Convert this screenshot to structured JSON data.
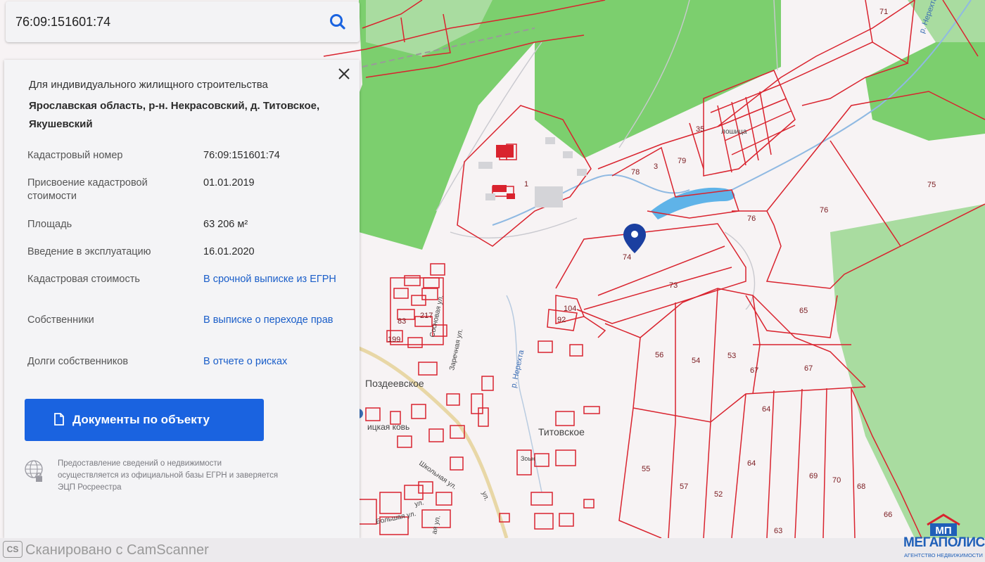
{
  "search": {
    "value": "76:09:151601:74"
  },
  "panel": {
    "purpose": "Для индивидуального жилищного строительства",
    "address": "Ярославская область, р-н. Некрасовский, д. Титовское, Якушевский",
    "rows": [
      {
        "label": "Кадастровый номер",
        "value": "76:09:151601:74"
      },
      {
        "label": "Присвоение кадастровой стоимости",
        "value": "01.01.2019"
      },
      {
        "label": "Площадь",
        "value": "63 206 м²"
      },
      {
        "label": "Введение в эксплуатацию",
        "value": "16.01.2020"
      },
      {
        "label": "Кадастровая стоимость",
        "value": "В срочной выписке из ЕГРН"
      },
      {
        "label": "Собственники",
        "value": "В выписке о переходе прав"
      },
      {
        "label": "Долги собственников",
        "value": "В отчете о рисках"
      }
    ],
    "documents_button": "Документы по объекту",
    "disclaimer": "Предоставление сведений о недвижимости осуществляется из официальной базы ЕГРН и заверяется ЭЦП Росреестра"
  },
  "map": {
    "places": {
      "pozdeevskoe": "Поздеевское",
      "titovskoe": "Титовское",
      "tserkov": "ицкая ковь",
      "river_nerekhta": "р. Нерехта",
      "river_nerekhta_top": "р. Нерехта",
      "street_sosnovaya": "Сосновая ул.",
      "street_zarechnaya": "Заречная ул.",
      "street_shkolnaya": "Школьная ул.",
      "street_ya": "ая ул.",
      "street_bottom": "ул.",
      "street_bolshaya": "Большая ул.",
      "street_bottom2": "ул.",
      "sub_village": "Зоьн",
      "poselok": "лошица"
    },
    "parcels": {
      "p74": "74",
      "p73": "73",
      "p104": "104",
      "p92": "92",
      "p78": "78",
      "p3": "3",
      "p79": "79",
      "p35": "35",
      "p1": "1",
      "p71": "71",
      "p75": "75",
      "p76a": "76",
      "p76b": "76",
      "p65": "65",
      "p56": "56",
      "p54": "54",
      "p53": "53",
      "p67a": "67",
      "p67b": "67",
      "p64a": "64",
      "p64b": "64",
      "p55": "55",
      "p57": "57",
      "p52": "52",
      "p69": "69",
      "p70": "70",
      "p68": "68",
      "p66": "66",
      "p63": "63",
      "p217": "217",
      "p83": "83",
      "p199": "199"
    },
    "colors": {
      "forest": "#7ccf6e",
      "forest_light": "#a9dca0",
      "border": "#d9232e",
      "water": "#5fb3e8",
      "pin": "#1b3fa0"
    }
  },
  "footer": {
    "cs": "CS",
    "scanner": "Сканировано с CamScanner"
  },
  "logo": {
    "letters": "МП",
    "name": "МЕГАПОЛИС",
    "sub": "АГЕНТСТВО НЕДВИЖИМОСТИ"
  }
}
